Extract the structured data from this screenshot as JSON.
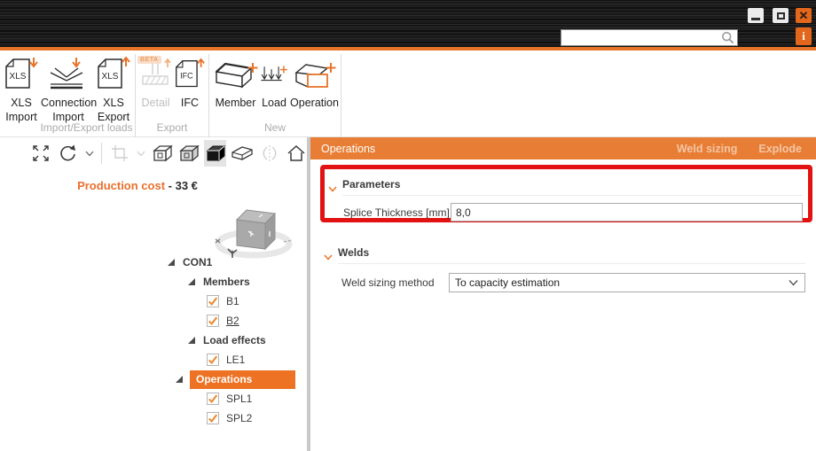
{
  "titlebar": {
    "close_glyph": "✕",
    "info_glyph": "i",
    "search": {
      "value": ""
    }
  },
  "ribbon": {
    "group_labels": [
      "Import/Export loads",
      "Export",
      "New"
    ],
    "xls_import": {
      "line1": "XLS",
      "line2": "Import",
      "doc_text": "XLS"
    },
    "connection_import": {
      "line1": "Connection",
      "line2": "Import"
    },
    "xls_export": {
      "line1": "XLS",
      "line2": "Export",
      "doc_text": "XLS"
    },
    "detail": {
      "label": "Detail",
      "badge": "BETA"
    },
    "ifc": {
      "label": "IFC",
      "doc_text": "IFC"
    },
    "member": {
      "label": "Member"
    },
    "load": {
      "label": "Load"
    },
    "operation": {
      "label": "Operation"
    }
  },
  "left_panel": {
    "production_cost_label": "Production cost",
    "production_cost_value": "- 33 €",
    "tree": {
      "root": "CON1",
      "groups": [
        {
          "label": "Members",
          "items": [
            "B1",
            "B2"
          ]
        },
        {
          "label": "Load effects",
          "items": [
            "LE1"
          ]
        },
        {
          "label": "Operations",
          "items": [
            "SPL1",
            "SPL2"
          ],
          "selected": true
        }
      ]
    }
  },
  "right_panel": {
    "header": {
      "title": "Operations",
      "action_weld_sizing": "Weld sizing",
      "action_explode": "Explode"
    },
    "sections": [
      {
        "title": "Parameters",
        "field_label": "Splice Thickness [mm]",
        "field_value": "8,0"
      },
      {
        "title": "Welds",
        "field_label": "Weld sizing method",
        "field_value": "To capacity estimation"
      }
    ]
  },
  "colors": {
    "accent_orange": "#e8742a",
    "tree_selection": "#ed7223",
    "panel_header": "#e87e35",
    "highlight_red": "#e21212"
  }
}
